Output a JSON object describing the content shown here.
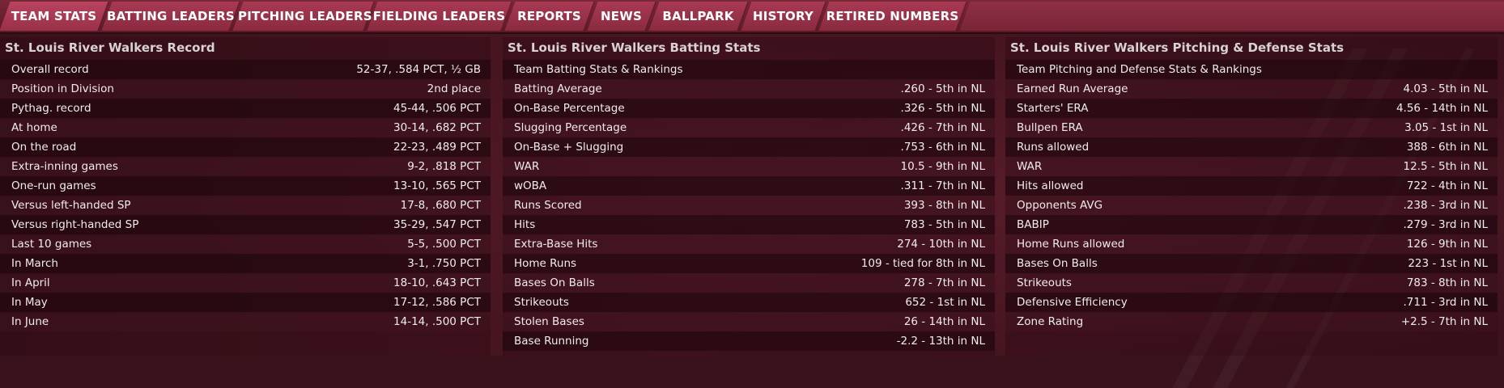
{
  "tabs": [
    {
      "label": "TEAM STATS",
      "active": true
    },
    {
      "label": "BATTING LEADERS"
    },
    {
      "label": "PITCHING LEADERS"
    },
    {
      "label": "FIELDING LEADERS"
    },
    {
      "label": "REPORTS"
    },
    {
      "label": "NEWS"
    },
    {
      "label": "BALLPARK"
    },
    {
      "label": "HISTORY"
    },
    {
      "label": "RETIRED NUMBERS"
    }
  ],
  "record": {
    "title": "St. Louis River Walkers Record",
    "rows": [
      {
        "label": "Overall record",
        "value": "52-37, .584 PCT, ½ GB"
      },
      {
        "label": "Position in Division",
        "value": "2nd place"
      },
      {
        "label": "Pythag. record",
        "value": "45-44, .506 PCT"
      },
      {
        "label": "At home",
        "value": "30-14, .682 PCT"
      },
      {
        "label": "On the road",
        "value": "22-23, .489 PCT"
      },
      {
        "label": "Extra-inning games",
        "value": "9-2, .818 PCT"
      },
      {
        "label": "One-run games",
        "value": "13-10, .565 PCT"
      },
      {
        "label": "Versus left-handed SP",
        "value": "17-8, .680 PCT"
      },
      {
        "label": "Versus right-handed SP",
        "value": "35-29, .547 PCT"
      },
      {
        "label": "Last 10 games",
        "value": "5-5, .500 PCT"
      },
      {
        "label": "In March",
        "value": "3-1, .750 PCT"
      },
      {
        "label": "In April",
        "value": "18-10, .643 PCT"
      },
      {
        "label": "In May",
        "value": "17-12, .586 PCT"
      },
      {
        "label": "In June",
        "value": "14-14, .500 PCT"
      }
    ]
  },
  "batting": {
    "title": "St. Louis River Walkers Batting Stats",
    "header": "Team Batting Stats & Rankings",
    "rows": [
      {
        "label": "Batting Average",
        "value": ".260 - 5th  in NL"
      },
      {
        "label": "On-Base Percentage",
        "value": ".326 - 5th  in NL"
      },
      {
        "label": "Slugging Percentage",
        "value": ".426 - 7th  in NL"
      },
      {
        "label": "On-Base + Slugging",
        "value": ".753 - 6th  in NL"
      },
      {
        "label": "WAR",
        "value": "10.5 - 9th  in NL"
      },
      {
        "label": "wOBA",
        "value": ".311 - 7th  in NL"
      },
      {
        "label": "Runs Scored",
        "value": "393 - 8th  in NL"
      },
      {
        "label": "Hits",
        "value": "783 - 5th  in NL"
      },
      {
        "label": "Extra-Base Hits",
        "value": "274 - 10th  in NL"
      },
      {
        "label": "Home Runs",
        "value": "109 -  tied for 8th  in NL"
      },
      {
        "label": "Bases On Balls",
        "value": "278 - 7th  in NL"
      },
      {
        "label": "Strikeouts",
        "value": "652 - 1st  in NL"
      },
      {
        "label": "Stolen Bases",
        "value": "26 - 14th  in NL"
      },
      {
        "label": "Base Running",
        "value": "-2.2 - 13th  in NL"
      }
    ]
  },
  "pitching": {
    "title": "St. Louis River Walkers Pitching & Defense Stats",
    "header": "Team Pitching and Defense Stats & Rankings",
    "rows": [
      {
        "label": "Earned Run Average",
        "value": "4.03 - 5th  in NL"
      },
      {
        "label": "Starters' ERA",
        "value": "4.56 - 14th  in NL"
      },
      {
        "label": "Bullpen ERA",
        "value": "3.05 - 1st  in NL"
      },
      {
        "label": "Runs allowed",
        "value": "388 - 6th  in NL"
      },
      {
        "label": "WAR",
        "value": "12.5 - 5th  in NL"
      },
      {
        "label": "Hits allowed",
        "value": "722 - 4th  in NL"
      },
      {
        "label": "Opponents AVG",
        "value": ".238 - 3rd  in NL"
      },
      {
        "label": "BABIP",
        "value": ".279 - 3rd  in NL"
      },
      {
        "label": "Home Runs allowed",
        "value": "126 - 9th  in NL"
      },
      {
        "label": "Bases On Balls",
        "value": "223 - 1st  in NL"
      },
      {
        "label": "Strikeouts",
        "value": "783 - 8th  in NL"
      },
      {
        "label": "Defensive Efficiency",
        "value": ".711 - 3rd  in NL"
      },
      {
        "label": "Zone Rating",
        "value": "+2.5 - 7th  in NL"
      }
    ]
  }
}
